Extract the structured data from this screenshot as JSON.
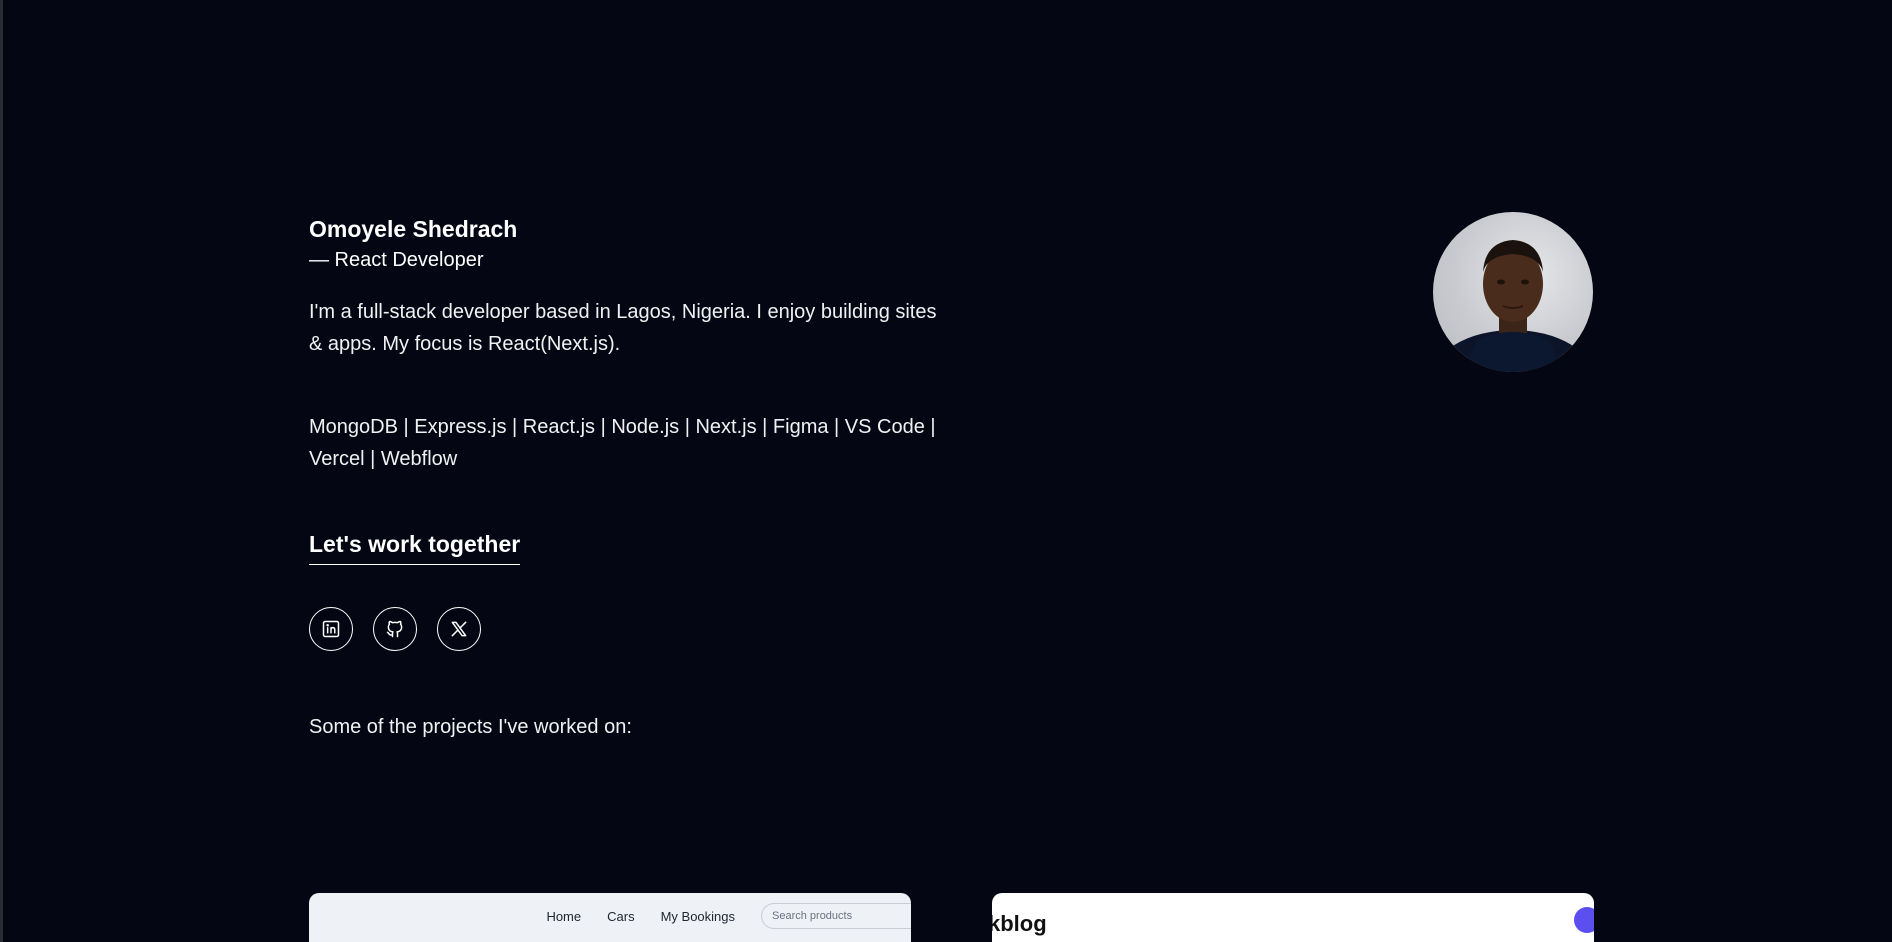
{
  "profile": {
    "name": "Omoyele Shedrach",
    "role": "— React Developer",
    "bio": "I'm a full-stack developer based in Lagos, Nigeria. I enjoy building sites & apps. My focus is React(Next.js).",
    "stack": "MongoDB | Express.js | React.js | Node.js | Next.js | Figma | VS Code | Vercel | Webflow",
    "avatar_icon": "portrait-photo"
  },
  "cta": {
    "label": "Let's work together"
  },
  "socials": [
    {
      "name": "linkedin-icon"
    },
    {
      "name": "github-icon"
    },
    {
      "name": "x-icon"
    }
  ],
  "projects": {
    "heading": "Some of the projects I've worked on:",
    "card1": {
      "nav_home": "Home",
      "nav_cars": "Cars",
      "nav_bookings": "My Bookings",
      "search_placeholder": "Search products"
    },
    "card2": {
      "logo": "kblog"
    }
  },
  "colors": {
    "background": "#040713",
    "text": "#ffffff",
    "accent": "#5b4ff0"
  }
}
